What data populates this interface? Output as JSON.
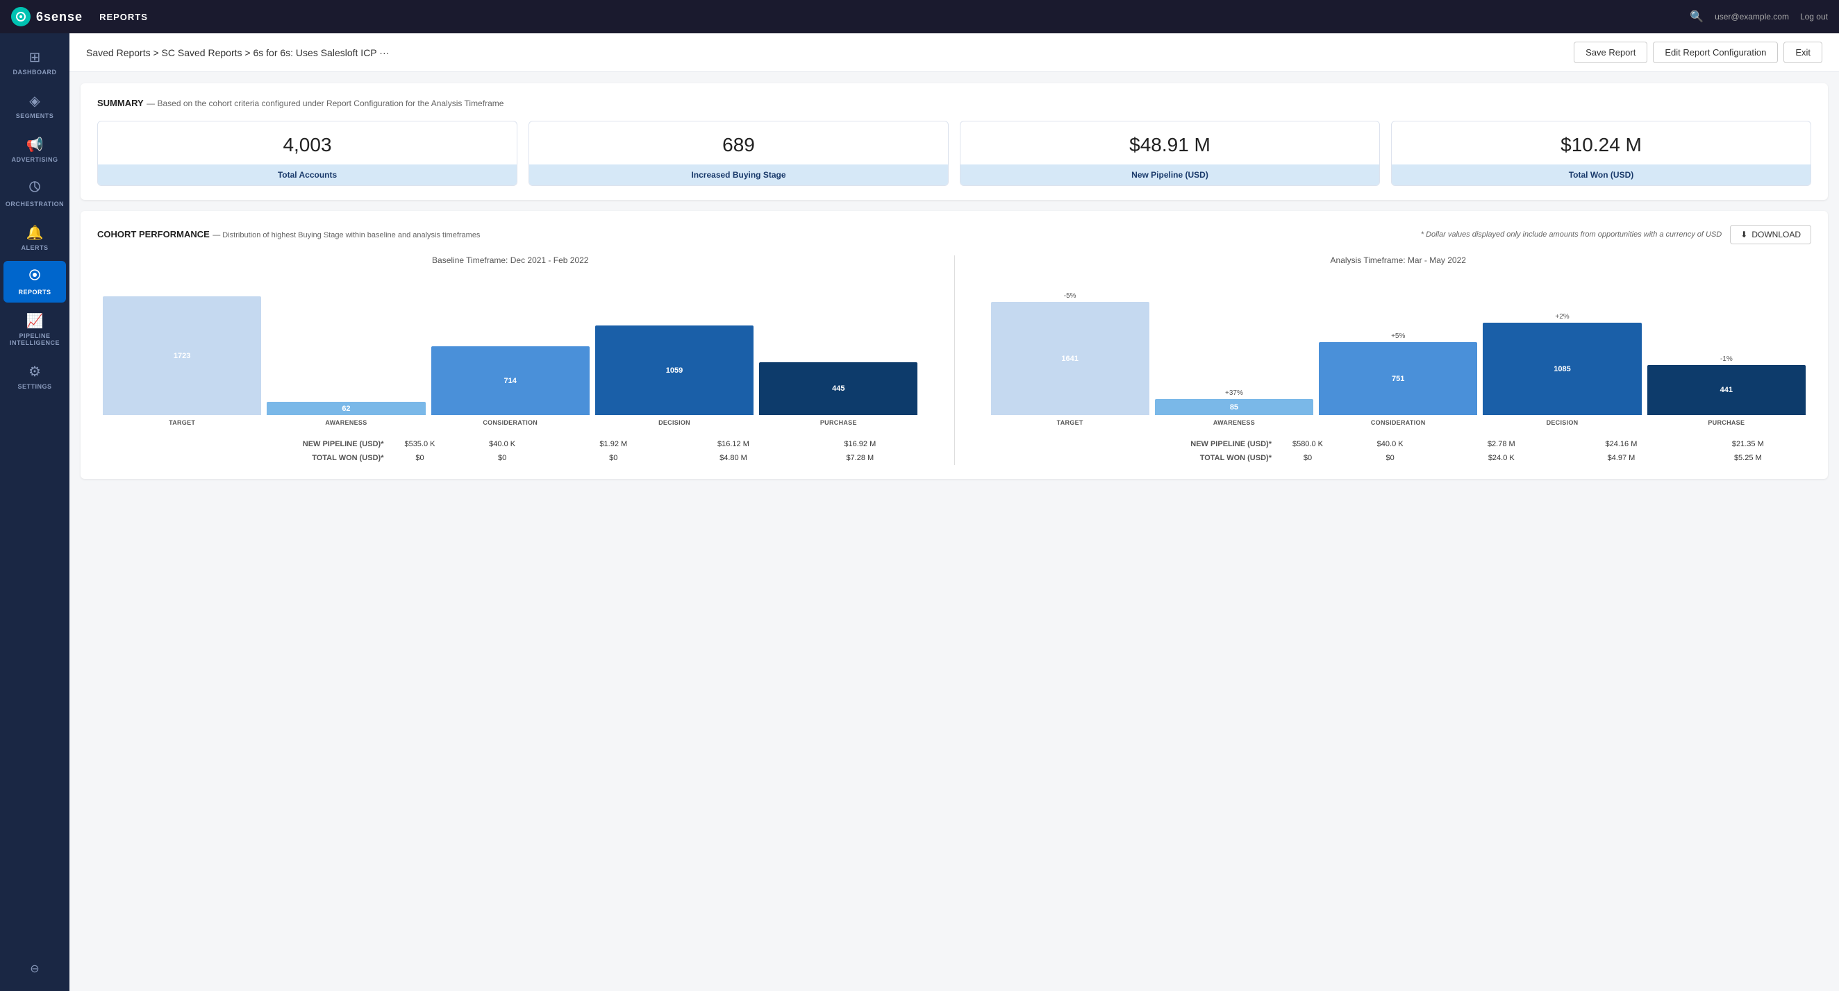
{
  "topnav": {
    "logo_text": "6sense",
    "title": "REPORTS",
    "user_email": "user@example.com",
    "logout_label": "Log out",
    "search_icon": "🔍"
  },
  "sidebar": {
    "items": [
      {
        "id": "dashboard",
        "label": "DASHBOARD",
        "icon": "⊞"
      },
      {
        "id": "segments",
        "label": "SEGMENTS",
        "icon": "◈"
      },
      {
        "id": "advertising",
        "label": "ADVERTISING",
        "icon": "📢"
      },
      {
        "id": "orchestration",
        "label": "ORCHESTRATION",
        "icon": "⟳"
      },
      {
        "id": "alerts",
        "label": "ALERTS",
        "icon": "🔔"
      },
      {
        "id": "reports",
        "label": "REPORTS",
        "icon": "◎",
        "active": true
      },
      {
        "id": "pipeline",
        "label": "PIPELINE INTELLIGENCE",
        "icon": "📈"
      },
      {
        "id": "settings",
        "label": "SETTINGS",
        "icon": "⚙"
      }
    ],
    "bottom_icon": "⊖"
  },
  "breadcrumb": {
    "path": "Saved Reports > SC Saved Reports > 6s for 6s: Uses Salesloft ICP ···",
    "save_label": "Save Report",
    "edit_label": "Edit Report Configuration",
    "exit_label": "Exit"
  },
  "summary": {
    "title": "SUMMARY",
    "subtitle": "— Based on the cohort criteria configured under Report Configuration for the Analysis Timeframe",
    "metrics": [
      {
        "value": "4,003",
        "label": "Total Accounts"
      },
      {
        "value": "689",
        "label": "Increased Buying Stage"
      },
      {
        "value": "$48.91 M",
        "label": "New Pipeline (USD)"
      },
      {
        "value": "$10.24 M",
        "label": "Total Won (USD)"
      }
    ]
  },
  "cohort": {
    "title": "COHORT PERFORMANCE",
    "subtitle": "— Distribution of highest Buying Stage within baseline and analysis timeframes",
    "note": "* Dollar values displayed only include amounts from opportunities with a currency of USD",
    "download_label": "DOWNLOAD",
    "baseline": {
      "title": "Baseline Timeframe: Dec 2021 - Feb 2022",
      "bars": [
        {
          "label": "TARGET",
          "value": 1723,
          "height_pct": 90,
          "color": "#c5d9f0",
          "change": ""
        },
        {
          "label": "AWARENESS",
          "value": 62,
          "height_pct": 10,
          "color": "#7ab8e8",
          "change": ""
        },
        {
          "label": "CONSIDERATION",
          "value": 714,
          "height_pct": 52,
          "color": "#4a90d9",
          "change": ""
        },
        {
          "label": "DECISION",
          "value": 1059,
          "height_pct": 68,
          "color": "#1a5fa8",
          "change": ""
        },
        {
          "label": "PURCHASE",
          "value": 445,
          "height_pct": 40,
          "color": "#0d3b6b",
          "change": ""
        }
      ],
      "rows": [
        {
          "metric": "NEW PIPELINE (USD)*",
          "values": [
            "$535.0 K",
            "$40.0 K",
            "$1.92 M",
            "$16.12 M",
            "$16.92 M"
          ]
        },
        {
          "metric": "TOTAL WON (USD)*",
          "values": [
            "$0",
            "$0",
            "$0",
            "$4.80 M",
            "$7.28 M"
          ]
        }
      ]
    },
    "analysis": {
      "title": "Analysis Timeframe: Mar - May 2022",
      "bars": [
        {
          "label": "TARGET",
          "value": 1641,
          "height_pct": 86,
          "color": "#c5d9f0",
          "change": "-5%"
        },
        {
          "label": "AWARENESS",
          "value": 85,
          "height_pct": 12,
          "color": "#7ab8e8",
          "change": "+37%"
        },
        {
          "label": "CONSIDERATION",
          "value": 751,
          "height_pct": 55,
          "color": "#4a90d9",
          "change": "+5%"
        },
        {
          "label": "DECISION",
          "value": 1085,
          "height_pct": 70,
          "color": "#1a5fa8",
          "change": "+2%"
        },
        {
          "label": "PURCHASE",
          "value": 441,
          "height_pct": 38,
          "color": "#0d3b6b",
          "change": "-1%"
        }
      ],
      "rows": [
        {
          "metric": "NEW PIPELINE (USD)*",
          "values": [
            "$580.0 K",
            "$40.0 K",
            "$2.78 M",
            "$24.16 M",
            "$21.35 M"
          ]
        },
        {
          "metric": "TOTAL WON (USD)*",
          "values": [
            "$0",
            "$0",
            "$24.0 K",
            "$4.97 M",
            "$5.25 M"
          ]
        }
      ]
    }
  }
}
